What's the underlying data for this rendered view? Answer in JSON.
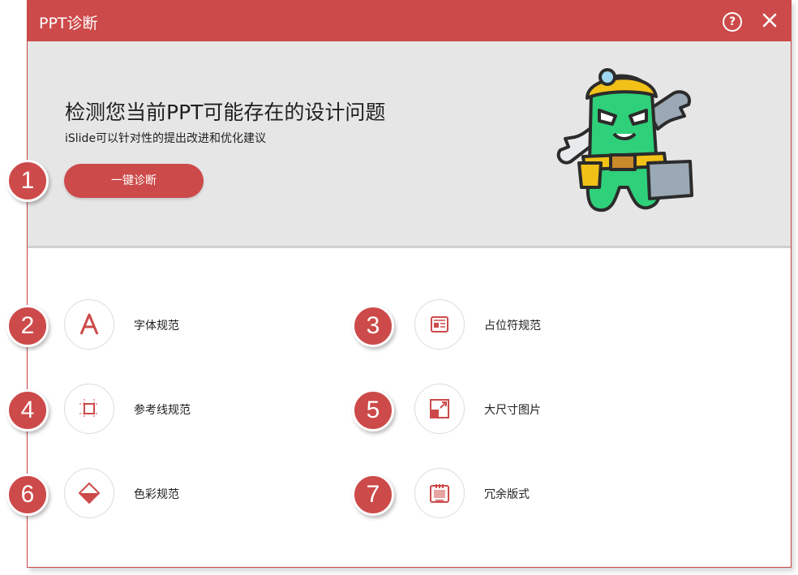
{
  "window": {
    "title": "PPT诊断",
    "help_icon": "help-circle-icon",
    "close_icon": "close-icon",
    "accent_color": "#cd4a4a"
  },
  "banner": {
    "headline": "检测您当前PPT可能存在的设计问题",
    "subline": "iSlide可以针对性的提出改进和优化建议",
    "button_label": "一键诊断",
    "mascot": "repair-mascot-illustration"
  },
  "items": [
    {
      "label": "字体规范",
      "icon": "font-a-icon"
    },
    {
      "label": "占位符规范",
      "icon": "placeholder-icon"
    },
    {
      "label": "参考线规范",
      "icon": "guides-icon"
    },
    {
      "label": "大尺寸图片",
      "icon": "large-image-icon"
    },
    {
      "label": "色彩规范",
      "icon": "color-diamond-icon"
    },
    {
      "label": "冗余版式",
      "icon": "redundant-layout-icon"
    }
  ],
  "badges": [
    "1",
    "2",
    "3",
    "4",
    "5",
    "6",
    "7"
  ]
}
